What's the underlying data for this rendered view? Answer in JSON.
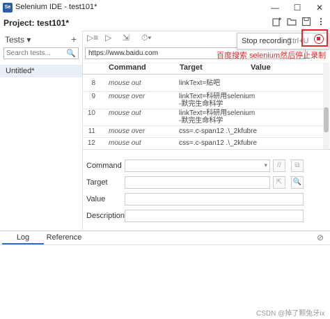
{
  "window": {
    "app_icon_text": "Se",
    "title": "Selenium IDE - test101*",
    "minimize": "—",
    "maximize": "☐",
    "close": "✕"
  },
  "project": {
    "label": "Project:  test101*",
    "icons": [
      "new-project-icon",
      "open-project-icon",
      "save-project-icon",
      "more-options-icon"
    ]
  },
  "sidebar": {
    "tests_label": "Tests  ▾",
    "add_label": "+",
    "search_placeholder": "Search tests...",
    "search_icon": "🔍",
    "items": [
      {
        "label": "Untitled*"
      }
    ]
  },
  "toolbar": {
    "run_all": "▷≡",
    "run": "▷",
    "step": "⇲",
    "speed": "⏱▾"
  },
  "url": {
    "value": "https://www.baidu.com"
  },
  "table": {
    "headers": [
      "Command",
      "Target",
      "Value"
    ],
    "rows": [
      {
        "num": "8",
        "command": "mouse out",
        "target": "linkText=贴吧",
        "value": ""
      },
      {
        "num": "9",
        "command": "mouse over",
        "target": "linkText=科研用selenium\n-默完生命科学",
        "value": ""
      },
      {
        "num": "10",
        "command": "mouse out",
        "target": "linkText=科研用selenium\n-默完生命科学",
        "value": ""
      },
      {
        "num": "11",
        "command": "mouse over",
        "target": "css=.c-span12 .\\_2kfubre",
        "value": ""
      },
      {
        "num": "12",
        "command": "mouse out",
        "target": "css=.c-span12 .\\_2kfubre",
        "value": ""
      }
    ]
  },
  "editor": {
    "command_label": "Command",
    "target_label": "Target",
    "value_label": "Value",
    "description_label": "Description",
    "comment_btn": "//",
    "open_btn": "⧉",
    "select_btn": "⇱",
    "find_btn": "🔍"
  },
  "popup": {
    "stop_label": "Stop recording",
    "shortcut": "Ctrl+U"
  },
  "annotation": "百度搜索 selenium然后停止录制",
  "bottom": {
    "tab_log": "Log",
    "tab_reference": "Reference",
    "clear_icon": "⊘"
  },
  "watermark": "CSDN @掉了颗兔牙ix",
  "colors": {
    "accent_red": "#e0282e",
    "tab_active": "#2a6fd1",
    "selected_row": "#e8eef5"
  }
}
